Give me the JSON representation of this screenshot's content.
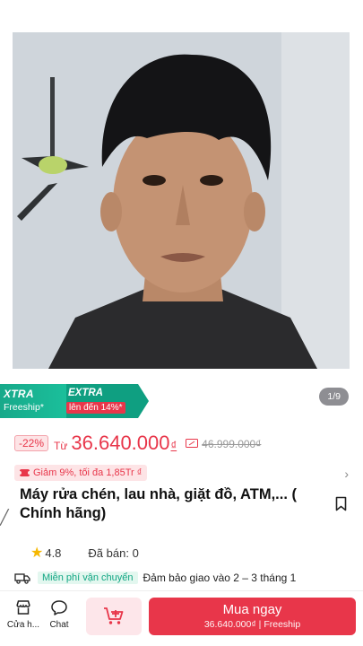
{
  "gallery": {
    "counter": "1/9"
  },
  "promo": {
    "xtra_title": "XTRA",
    "xtra_sub": "Freeship*",
    "extra_title": "EXTRA",
    "extra_sub": "lên đến 14%*"
  },
  "price": {
    "discount_badge": "-22%",
    "from_label": "Từ",
    "current": "36.640.000",
    "currency": "₫",
    "original": "46.999.000₫"
  },
  "voucher": {
    "text": "Giảm 9%, tối đa 1,85Tr ₫"
  },
  "product": {
    "title": "Máy rửa chén, lau nhà, giặt đồ, ATM,... ( Chính hãng)"
  },
  "rating": {
    "score": "4.8",
    "sold": "Đã bán: 0"
  },
  "shipping": {
    "badge": "Miễn phí vận chuyển",
    "text": "Đảm bảo giao vào 2 – 3 tháng 1"
  },
  "bottom_bar": {
    "shop_label": "Cửa h...",
    "chat_label": "Chat",
    "buy_label": "Mua ngay",
    "buy_sub": "36.640.000₫ | Freeship"
  },
  "colors": {
    "accent": "#e8364a",
    "promo_green": "#17a98a"
  },
  "icons": [
    "shop-icon",
    "chat-icon",
    "add-to-cart-icon",
    "bookmark-icon",
    "truck-icon",
    "star-icon",
    "voucher-icon",
    "chevron-right-icon"
  ]
}
